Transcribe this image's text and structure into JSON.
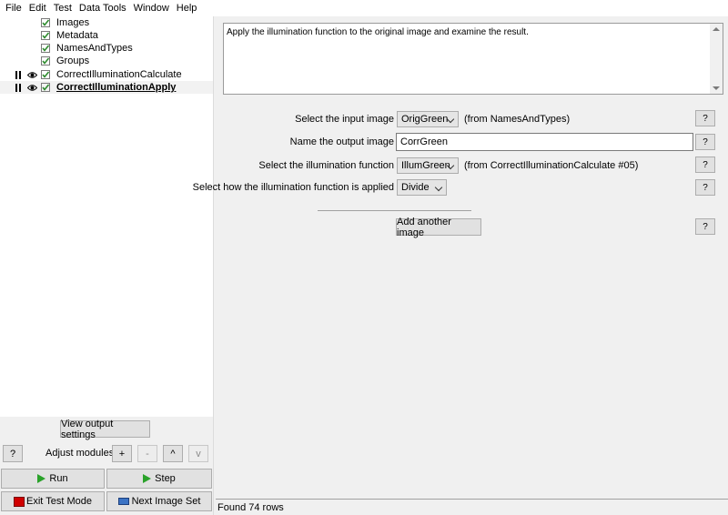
{
  "menu": [
    "File",
    "Edit",
    "Test",
    "Data Tools",
    "Window",
    "Help"
  ],
  "modules": [
    {
      "label": "Images",
      "paused": false,
      "visible": false,
      "selected": false
    },
    {
      "label": "Metadata",
      "paused": false,
      "visible": false,
      "selected": false
    },
    {
      "label": "NamesAndTypes",
      "paused": false,
      "visible": false,
      "selected": false
    },
    {
      "label": "Groups",
      "paused": false,
      "visible": false,
      "selected": false
    },
    {
      "label": "CorrectIlluminationCalculate",
      "paused": true,
      "visible": true,
      "selected": false
    },
    {
      "label": "CorrectIlluminationApply",
      "paused": true,
      "visible": true,
      "selected": true
    }
  ],
  "left_controls": {
    "view_output": "View output settings",
    "help": "?",
    "adjust_label": "Adjust modules:",
    "add": "+",
    "remove": "-",
    "up": "^",
    "down": "v",
    "run": "Run",
    "step": "Step",
    "exit_test": "Exit Test Mode",
    "next_image": "Next Image Set"
  },
  "notes": "Apply the illumination function to the original image and examine the result.",
  "settings": {
    "input_label": "Select the input image",
    "input_value": "OrigGreen",
    "input_source": "(from NamesAndTypes)",
    "output_label": "Name the output image",
    "output_value": "CorrGreen",
    "illum_label": "Select the illumination function",
    "illum_value": "IllumGreen",
    "illum_source": "(from CorrectIlluminationCalculate #05)",
    "method_label": "Select how the illumination function is applied",
    "method_value": "Divide",
    "add_image": "Add another image",
    "help": "?"
  },
  "status": "Found 74 rows",
  "colors": {
    "run": "#2aa22a",
    "stop": "#d00000",
    "check": "#2e8b2e"
  }
}
